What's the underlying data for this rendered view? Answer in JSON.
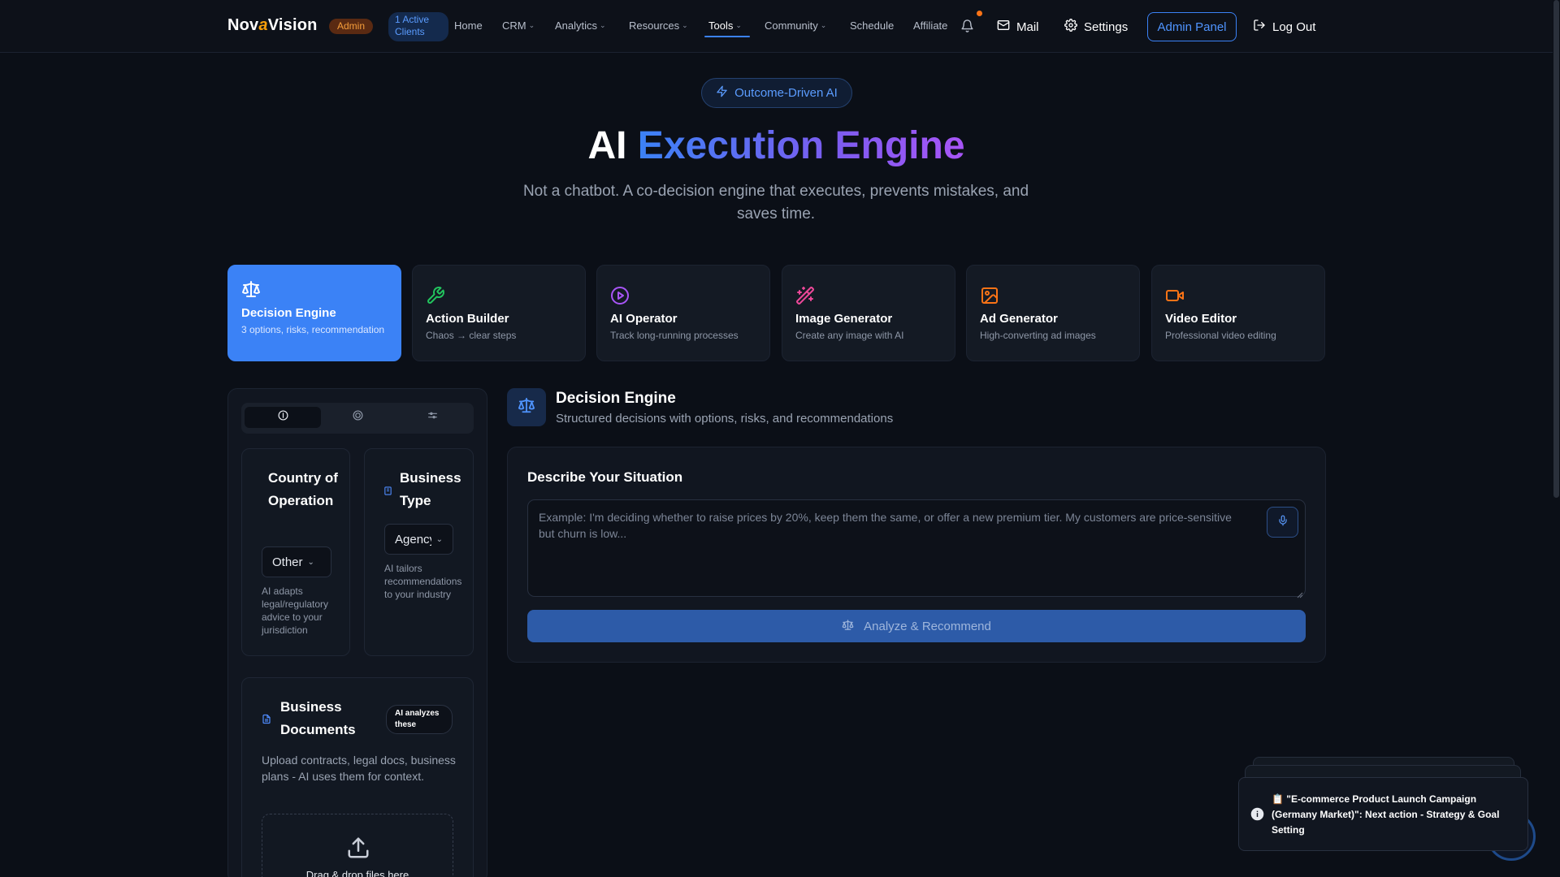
{
  "nav": {
    "brand_prefix": "Nov",
    "brand_accent": "a",
    "brand_suffix": "Vision",
    "admin_badge": "Admin",
    "clients_badge": "1 Active Clients",
    "items": [
      {
        "label": "Home",
        "dropdown": false
      },
      {
        "label": "CRM",
        "dropdown": true
      },
      {
        "label": "Analytics",
        "dropdown": true
      },
      {
        "label": "Resources",
        "dropdown": true
      },
      {
        "label": "Tools",
        "dropdown": true,
        "active": true
      },
      {
        "label": "Community",
        "dropdown": true
      },
      {
        "label": "Schedule",
        "dropdown": false
      },
      {
        "label": "Affiliate",
        "dropdown": false
      }
    ],
    "mail_label": "Mail",
    "settings_label": "Settings",
    "admin_panel_label": "Admin Panel",
    "logout_label": "Log Out"
  },
  "hero": {
    "pill_label": "Outcome-Driven AI",
    "title_plain": "AI",
    "title_gradient": "Execution Engine",
    "subtitle": "Not a chatbot. A co-decision engine that executes, prevents mistakes, and saves time."
  },
  "tools": [
    {
      "name": "Decision Engine",
      "desc": "3 options, risks, recommendation",
      "icon": "scale-icon",
      "color": "#ffffff",
      "active": true
    },
    {
      "name": "Action Builder",
      "desc": "Chaos → clear steps",
      "icon": "wrench-icon",
      "color": "#22c55e",
      "active": false
    },
    {
      "name": "AI Operator",
      "desc": "Track long-running processes",
      "icon": "play-circle-icon",
      "color": "#a855f7",
      "active": false
    },
    {
      "name": "Image Generator",
      "desc": "Create any image with AI",
      "icon": "magic-wand-icon",
      "color": "#ec4899",
      "active": false
    },
    {
      "name": "Ad Generator",
      "desc": "High-converting ad images",
      "icon": "image-icon",
      "color": "#f97316",
      "active": false
    },
    {
      "name": "Video Editor",
      "desc": "Professional video editing",
      "icon": "video-icon",
      "color": "#f97316",
      "active": false
    }
  ],
  "left_panel": {
    "country": {
      "title": "Country of Operation",
      "value": "Other",
      "hint": "AI adapts legal/regulatory advice to your jurisdiction"
    },
    "business_type": {
      "title": "Business Type",
      "value": "Agency",
      "hint": "AI tailors recommendations to your industry"
    },
    "documents": {
      "title": "Business Documents",
      "badge": "AI analyzes these",
      "desc": "Upload contracts, legal docs, business plans - AI uses them for context.",
      "dropzone": "Drag & drop files here"
    }
  },
  "engine": {
    "title": "Decision Engine",
    "subtitle": "Structured decisions with options, risks, and recommendations",
    "situation_title": "Describe Your Situation",
    "placeholder": "Example: I'm deciding whether to raise prices by 20%, keep them the same, or offer a new premium tier. My customers are price-sensitive but churn is low...",
    "analyze_label": "Analyze & Recommend"
  },
  "toast": {
    "emoji": "📋",
    "text": "\"E-commerce Product Launch Campaign (Germany Market)\": Next action - Strategy & Goal Setting"
  },
  "colors": {
    "accent": "#3b82f6",
    "admin_badge": "#f59e3b",
    "background": "#0b0f17"
  }
}
